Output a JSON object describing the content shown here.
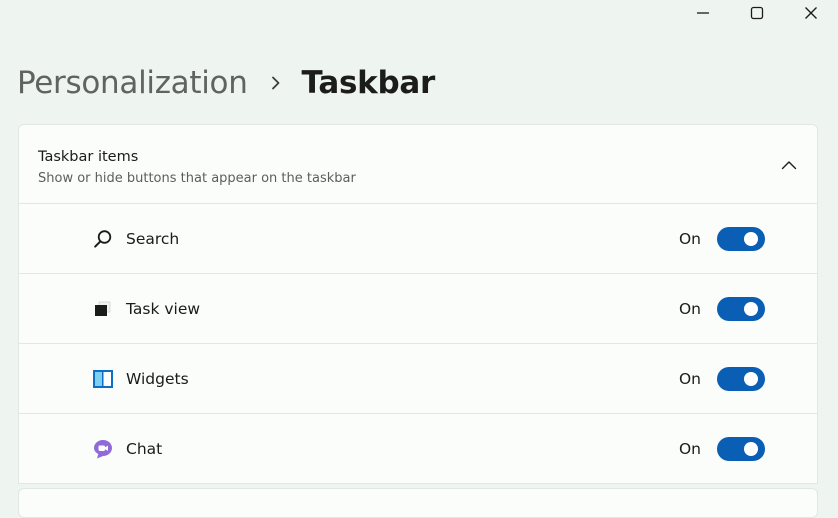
{
  "window": {
    "controls": [
      {
        "name": "minimize-button",
        "icon": "minimize-icon"
      },
      {
        "name": "maximize-button",
        "icon": "maximize-icon"
      },
      {
        "name": "close-button",
        "icon": "close-icon"
      }
    ]
  },
  "breadcrumb": {
    "parent": "Personalization",
    "separator_icon": "chevron-right-icon",
    "current": "Taskbar"
  },
  "section": {
    "title": "Taskbar items",
    "subtitle": "Show or hide buttons that appear on the taskbar",
    "expanded": true,
    "chevron_icon": "chevron-up-icon",
    "items": [
      {
        "label": "Search",
        "icon": "search-icon",
        "state": "On",
        "enabled": true
      },
      {
        "label": "Task view",
        "icon": "task-view-icon",
        "state": "On",
        "enabled": true
      },
      {
        "label": "Widgets",
        "icon": "widgets-icon",
        "state": "On",
        "enabled": true
      },
      {
        "label": "Chat",
        "icon": "chat-icon",
        "state": "On",
        "enabled": true
      }
    ]
  },
  "colors": {
    "accent": "#0a5fb4",
    "background": "#eef4ef",
    "card": "#fbfdfb"
  }
}
